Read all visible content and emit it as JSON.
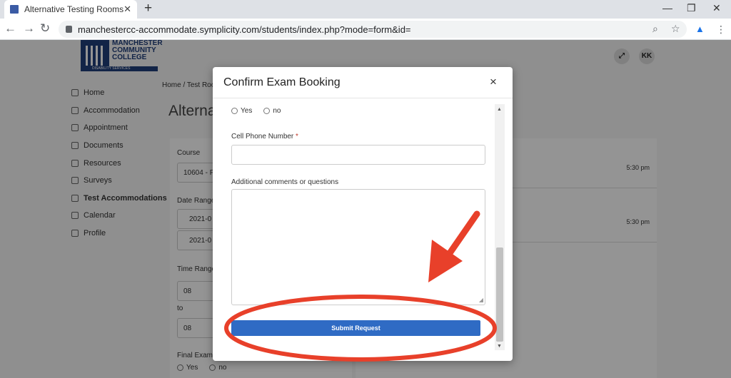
{
  "browser": {
    "tab_title": "Alternative Testing Rooms",
    "tab_close": "✕",
    "new_tab": "+",
    "url": "manchestercc-accommodate.symplicity.com/students/index.php?mode=form&id=",
    "back": "←",
    "forward": "→",
    "reload": "↻",
    "minimize": "—",
    "restore": "❐",
    "close": "✕"
  },
  "logo": {
    "line1": "MANCHESTER",
    "line2": "COMMUNITY",
    "line3": "COLLEGE",
    "sub": "DISABILITY SERVICES"
  },
  "header": {
    "avatar_initials": "KK"
  },
  "sidebar": {
    "items": [
      {
        "label": "Home",
        "icon": "home-icon"
      },
      {
        "label": "Accommodation",
        "icon": "accommodation-icon"
      },
      {
        "label": "Appointment",
        "icon": "appointment-icon"
      },
      {
        "label": "Documents",
        "icon": "documents-icon"
      },
      {
        "label": "Resources",
        "icon": "resources-icon"
      },
      {
        "label": "Surveys",
        "icon": "surveys-icon"
      },
      {
        "label": "Test Accommodations",
        "icon": "test-icon"
      },
      {
        "label": "Calendar",
        "icon": "calendar-icon"
      },
      {
        "label": "Profile",
        "icon": "profile-icon"
      }
    ]
  },
  "background": {
    "breadcrumb": "Home  /  Test Roo",
    "page_title": "Alterna",
    "course_label": "Course",
    "course_value": "10604 - F",
    "date_range_label": "Date Range",
    "date1": "2021-0",
    "date2": "2021-0",
    "time_range_label": "Time Range",
    "time1": "08",
    "to_label": "to",
    "time2": "08",
    "final_exam_label": "Final Exam",
    "yes": "Yes",
    "no": "no",
    "row1_time": "5:30 pm",
    "row2_time": "5:30 pm"
  },
  "modal": {
    "title": "Confirm Exam Booking",
    "close": "×",
    "radio_yes": "Yes",
    "radio_no": "no",
    "phone_label": "Cell Phone Number",
    "required_mark": "*",
    "comments_label": "Additional comments or questions",
    "submit_label": "Submit Request"
  }
}
